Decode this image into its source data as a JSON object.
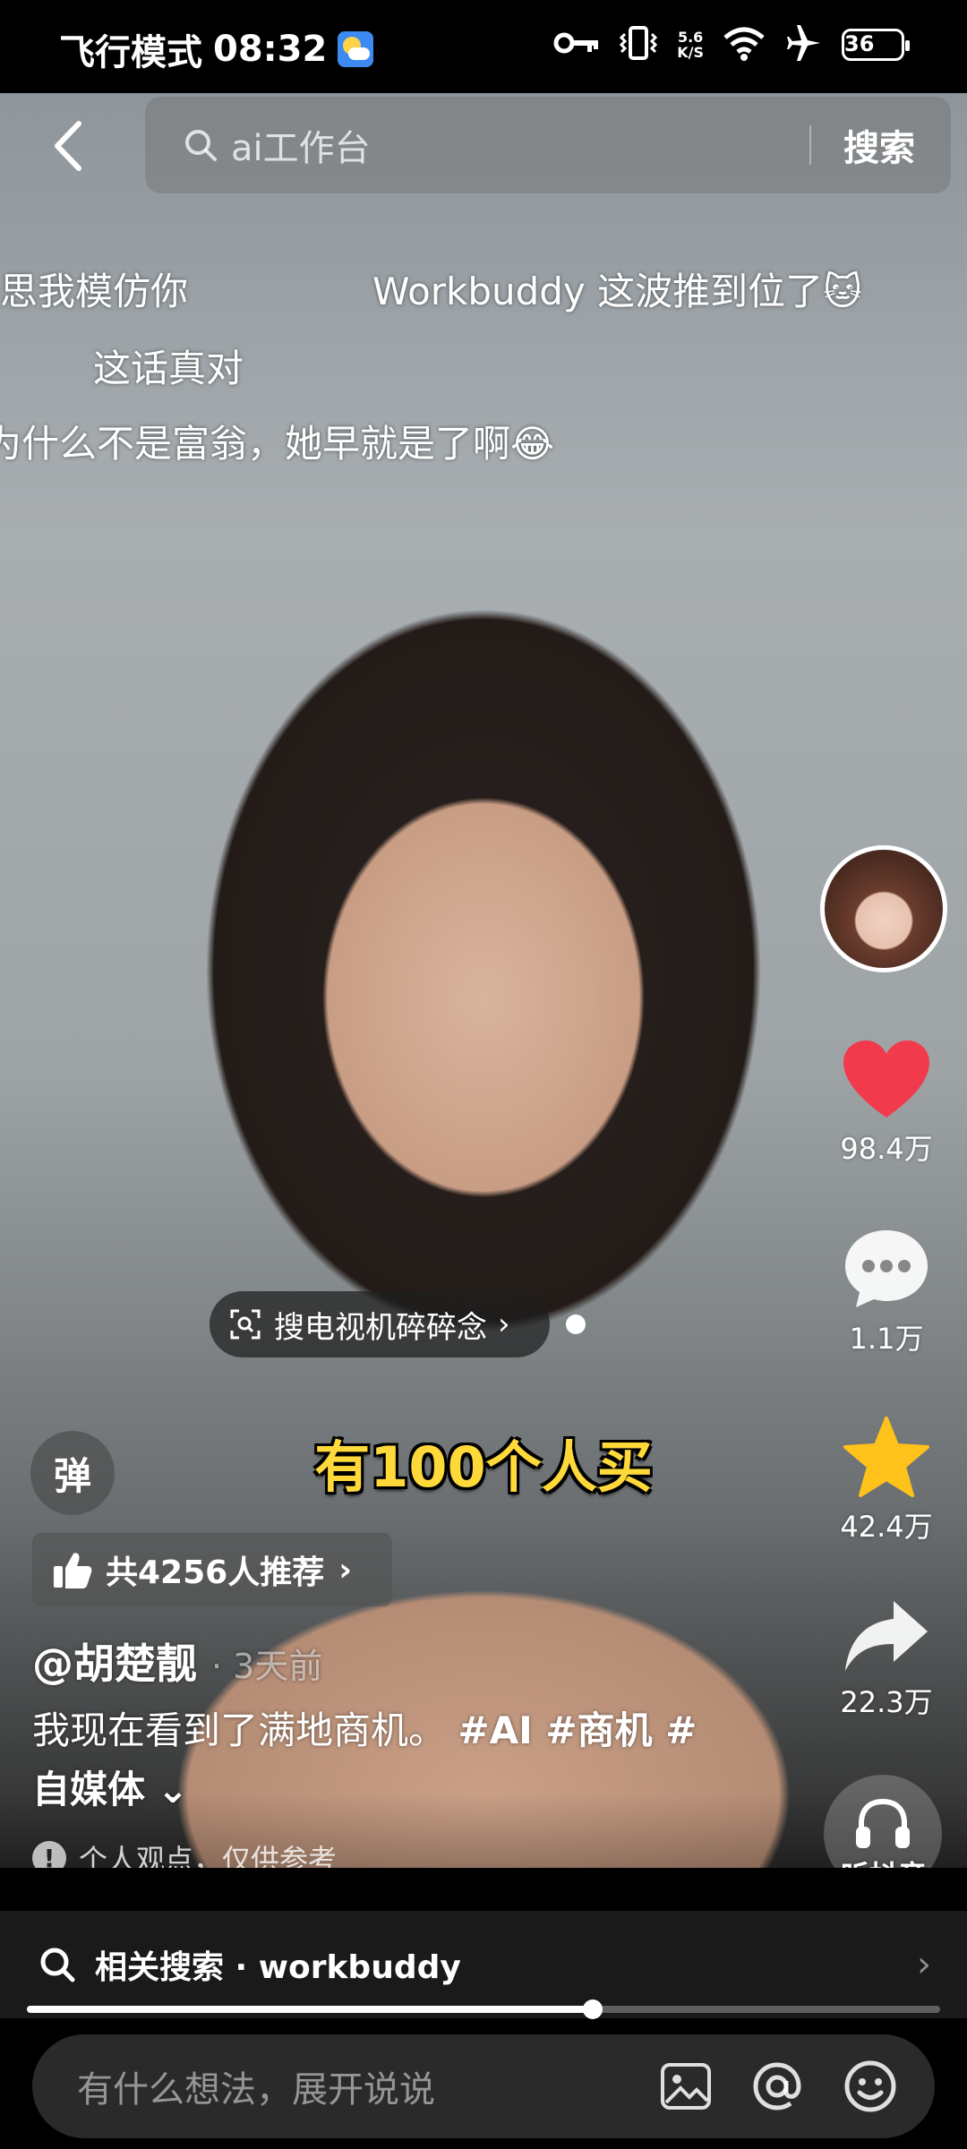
{
  "status_bar": {
    "mode": "飞行模式",
    "time": "08:32",
    "net_speed_top": "5.6",
    "net_speed_bottom": "K/S",
    "battery": "36"
  },
  "search": {
    "query": "ai工作台",
    "button": "搜索"
  },
  "danmaku": [
    "思我模仿你",
    "Workbuddy 这波推到位了🐱",
    "这话真对",
    "为什么不是富翁，她早就是了啊😂"
  ],
  "rail": {
    "likes": "98.4万",
    "comments": "1.1万",
    "favorites": "42.4万",
    "shares": "22.3万",
    "listen": "听抖音"
  },
  "overlay": {
    "search_chip": "搜电视机碎碎念",
    "caption": "有100个人买",
    "danmu_btn": "弹",
    "recommend": "共4256人推荐"
  },
  "post": {
    "author": "@胡楚靓",
    "time": "· 3天前",
    "desc": "我现在看到了满地商机。",
    "tags": "#AI #商机 #",
    "tag_tail": "自媒体",
    "notice": "个人观点，仅供参考"
  },
  "related": {
    "label": "相关搜索 · workbuddy"
  },
  "progress": {
    "fraction": 0.62
  },
  "comment": {
    "placeholder": "有什么想法，展开说说"
  },
  "colors": {
    "like": "#f23a4d",
    "favorite": "#ffc21a",
    "caption": "#ffd93a"
  }
}
